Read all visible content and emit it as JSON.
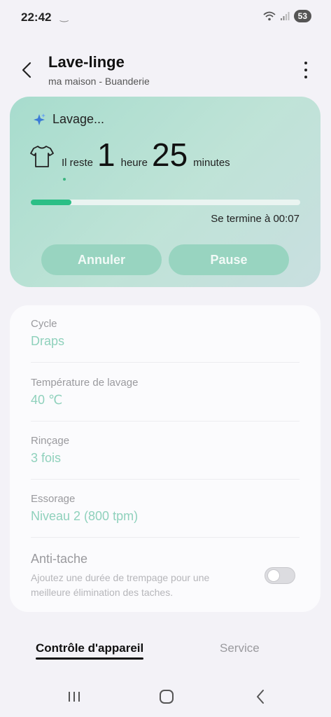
{
  "status_bar": {
    "time": "22:42",
    "dash": "‿",
    "battery": "53",
    "icons": [
      "wifi-icon",
      "signal-icon"
    ]
  },
  "header": {
    "title": "Lave-linge",
    "subtitle": "ma maison - Buanderie",
    "icons": [
      "back-arrow-icon",
      "more-vertical-icon"
    ]
  },
  "status": {
    "state_label": "Lavage...",
    "remaining_prefix": "Il reste",
    "hours": "1",
    "hours_unit": "heure",
    "minutes": "25",
    "minutes_unit": "minutes",
    "progress_percent": 15,
    "end_text": "Se termine à 00:07",
    "cancel_label": "Annuler",
    "pause_label": "Pause",
    "icons": [
      "sparkle-icon",
      "shirt-icon"
    ],
    "colors": {
      "accent": "#2bbf86",
      "card_bg": "#b7e0d3"
    }
  },
  "settings": {
    "items": [
      {
        "label": "Cycle",
        "value": "Draps"
      },
      {
        "label": "Température de lavage",
        "value": "40 ℃"
      },
      {
        "label": "Rinçage",
        "value": "3 fois"
      },
      {
        "label": "Essorage",
        "value": "Niveau 2 (800 tpm)"
      }
    ],
    "anti_stain": {
      "title": "Anti-tache",
      "description": "Ajoutez une durée de trempage pour une meilleure élimination des taches.",
      "enabled": false
    },
    "colors": {
      "value_text": "#8fd1bc"
    }
  },
  "tabs": {
    "device_control": "Contrôle d'appareil",
    "service": "Service",
    "active": "device_control"
  },
  "navbar": {
    "icons": [
      "recent-apps-icon",
      "home-icon",
      "back-icon"
    ]
  }
}
